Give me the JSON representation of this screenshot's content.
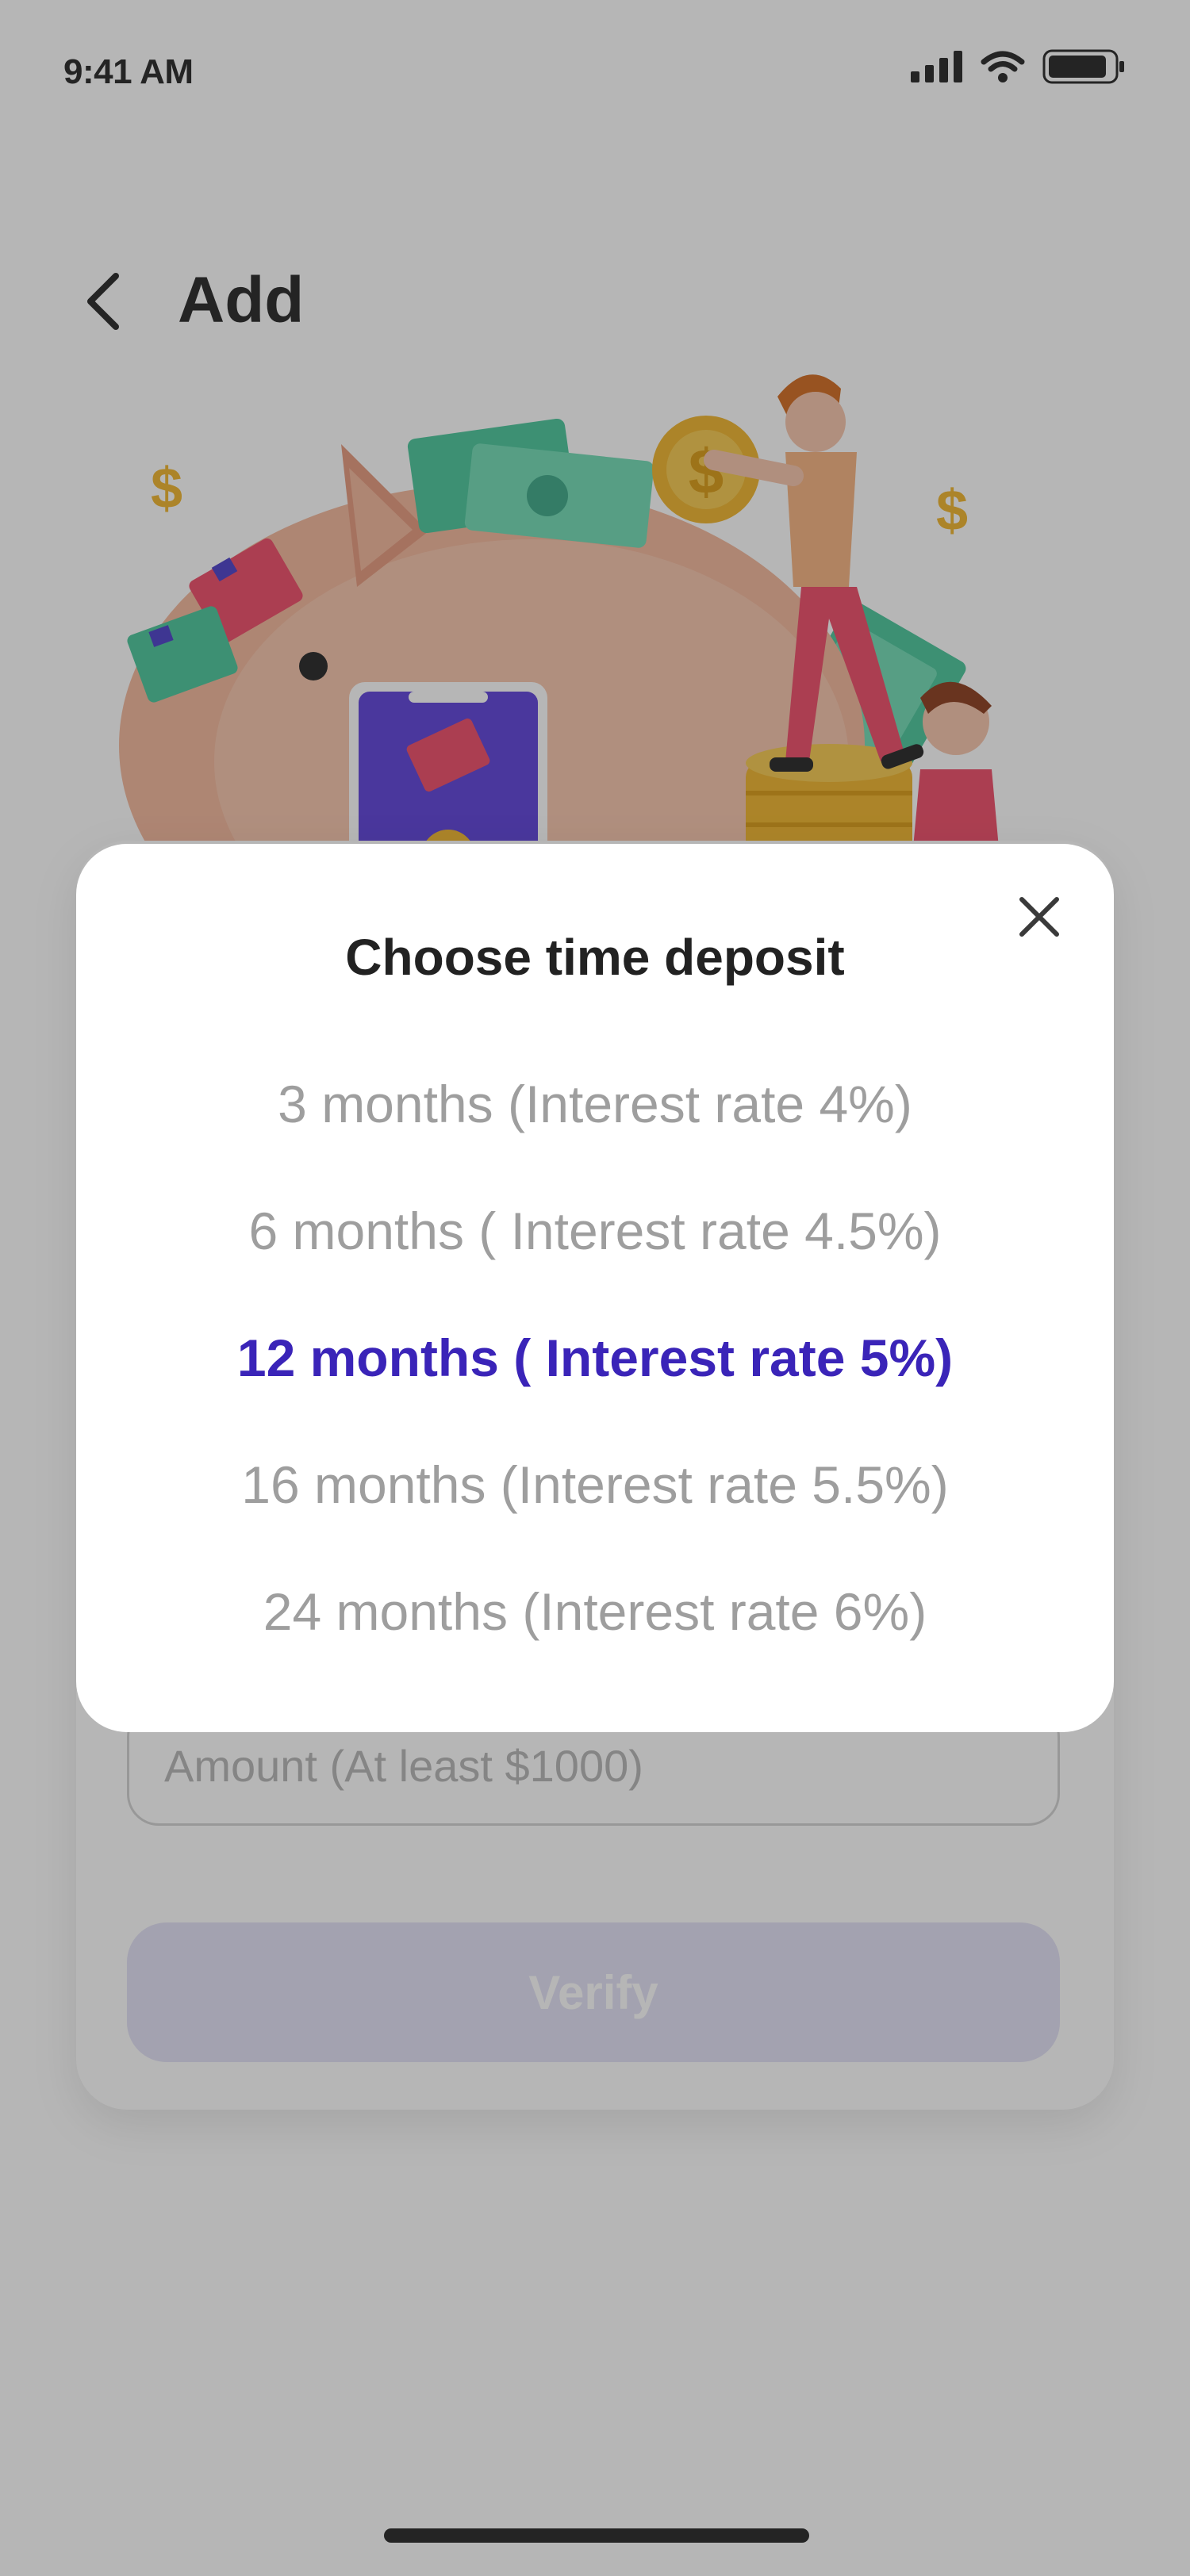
{
  "status_bar": {
    "time": "9:41 AM",
    "icons": [
      "cellular-signal-icon",
      "wifi-icon",
      "battery-icon"
    ]
  },
  "header": {
    "back_icon": "chevron-left-icon",
    "title": "Add"
  },
  "illustration": {
    "icon": "piggy-bank-illustration"
  },
  "form": {
    "amount_placeholder": "Amount (At least $1000)",
    "verify_label": "Verify"
  },
  "modal": {
    "title": "Choose time deposit",
    "close_icon": "close-icon",
    "options": [
      {
        "label": "3 months (Interest rate 4%)",
        "selected": false
      },
      {
        "label": "6 months ( Interest rate 4.5%)",
        "selected": false
      },
      {
        "label": "12 months ( Interest rate 5%)",
        "selected": true
      },
      {
        "label": "16 months (Interest rate 5.5%)",
        "selected": false
      },
      {
        "label": "24 months (Interest rate 6%)",
        "selected": false
      }
    ]
  },
  "colors": {
    "accent": "#3a24b8",
    "option_text": "#9e9e9e",
    "overlay": "#282828",
    "verify_button": "#e3e1f6"
  }
}
